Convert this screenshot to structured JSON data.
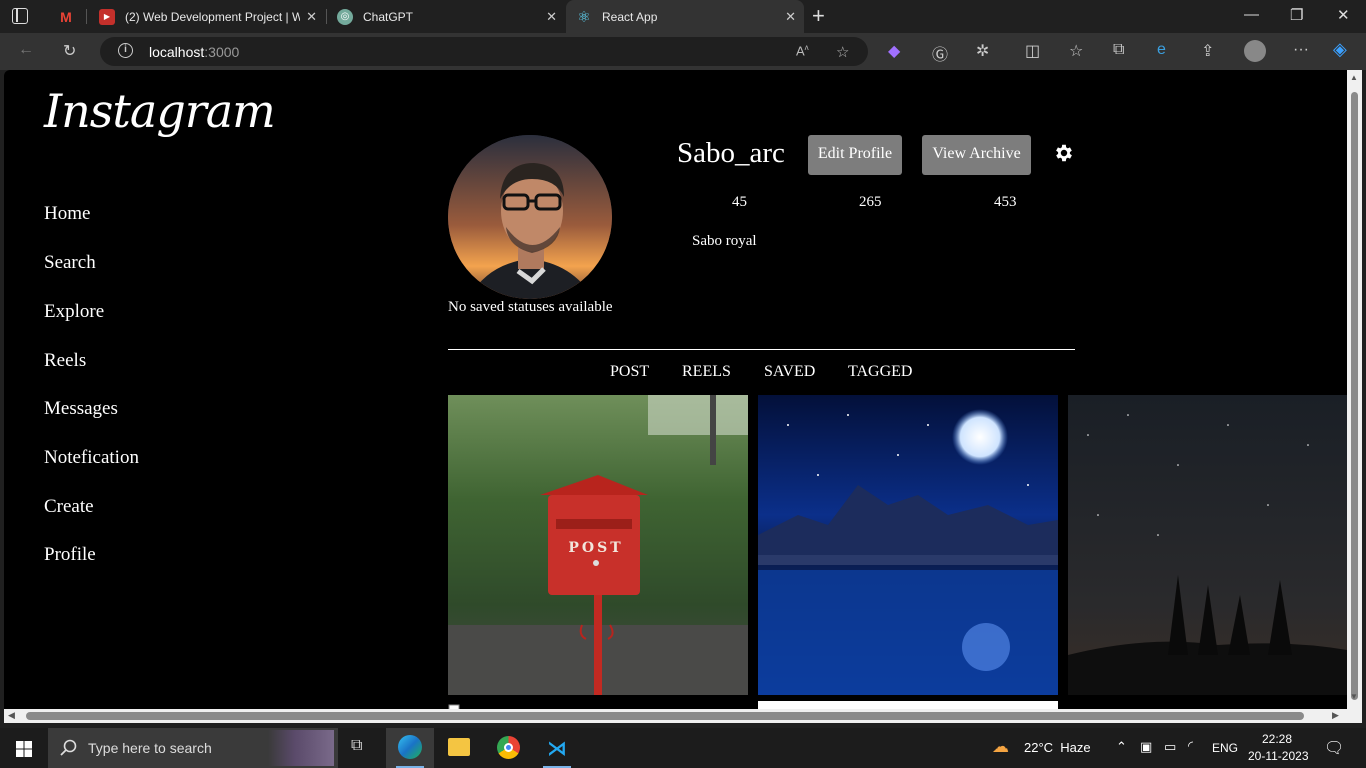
{
  "browser": {
    "tabs": [
      {
        "title": "",
        "favicon": "gmail-icon",
        "color": "#ea4335"
      },
      {
        "title": "(2) Web Development Project | W",
        "favicon": "youtube-icon",
        "color": "#ff0000"
      },
      {
        "title": "ChatGPT",
        "favicon": "chatgpt-icon",
        "color": "#74aa9c"
      },
      {
        "title": "React App",
        "favicon": "react-icon",
        "color": "#61dafb"
      }
    ],
    "address": {
      "host": "localhost",
      "port": ":3000"
    }
  },
  "app": {
    "logo": "Instagram",
    "nav": [
      "Home",
      "Search",
      "Explore",
      "Reels",
      "Messages",
      "Notefication",
      "Create",
      "Profile"
    ],
    "profile": {
      "username": "Sabo_arc",
      "edit_label": "Edit Profile",
      "archive_label": "View Archive",
      "stats": [
        "45",
        "265",
        "453"
      ],
      "full_name": "Sabo royal",
      "no_saved": "No saved statuses available"
    },
    "tabs": [
      "POST",
      "REELS",
      "SAVED",
      "TAGGED"
    ],
    "posts": [
      {
        "name": "post-red-mailbox",
        "caption": "POST"
      },
      {
        "name": "post-moon-lake"
      },
      {
        "name": "post-starry-forest"
      }
    ]
  },
  "taskbar": {
    "search_placeholder": "Type here to search",
    "weather": "22°C  Haze",
    "lang": "ENG",
    "time": "22:28",
    "date": "20-11-2023"
  }
}
